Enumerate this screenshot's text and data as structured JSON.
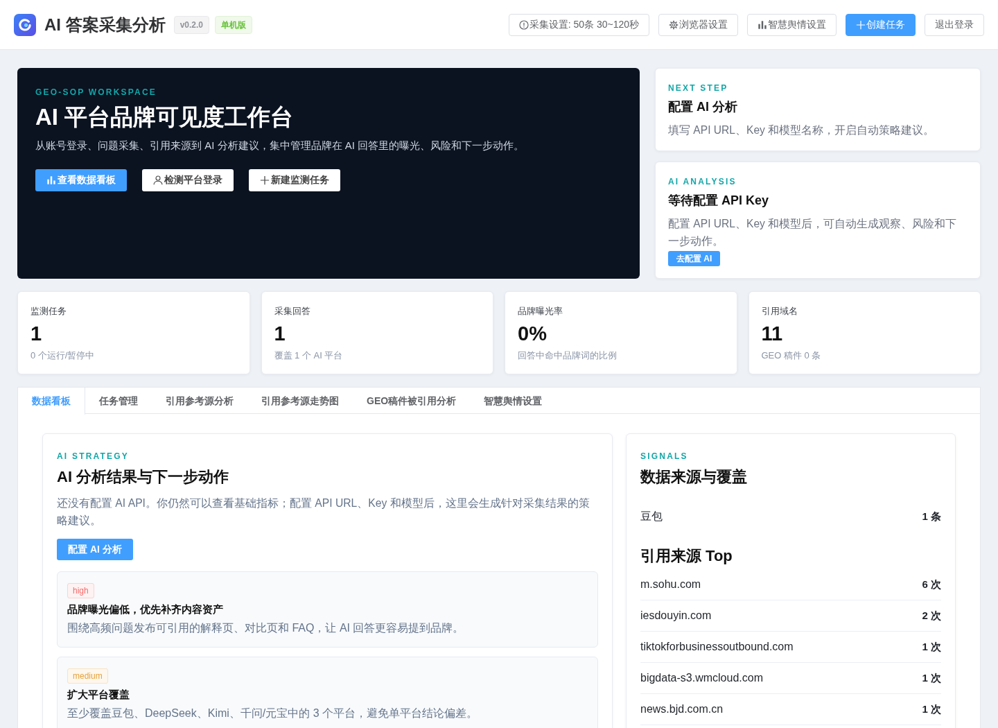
{
  "header": {
    "app_title": "AI 答案采集分析",
    "version": "v0.2.0",
    "edition": "单机版",
    "buttons": [
      {
        "label": "采集设置: 50条 30~120秒",
        "kind": "default"
      },
      {
        "label": "浏览器设置",
        "kind": "default"
      },
      {
        "label": "智慧舆情设置",
        "kind": "default"
      },
      {
        "label": "创建任务",
        "kind": "primary"
      },
      {
        "label": "退出登录",
        "kind": "default"
      }
    ]
  },
  "hero": {
    "eyebrow": "GEO-SOP WORKSPACE",
    "title": "AI 平台品牌可见度工作台",
    "description": "从账号登录、问题采集、引用来源到 AI 分析建议，集中管理品牌在 AI 回答里的曝光、风险和下一步动作。",
    "buttons": [
      {
        "label": "查看数据看板",
        "kind": "primary"
      },
      {
        "label": "检测平台登录",
        "kind": "default"
      },
      {
        "label": "新建监测任务",
        "kind": "default"
      }
    ]
  },
  "side_cards": [
    {
      "eyebrow": "NEXT STEP",
      "title": "配置 AI 分析",
      "description": "填写 API URL、Key 和模型名称，开启自动策略建议。"
    },
    {
      "eyebrow": "AI ANALYSIS",
      "title": "等待配置 API Key",
      "description": "配置 API URL、Key 和模型后，可自动生成观察、风险和下一步动作。",
      "button": "去配置 AI"
    }
  ],
  "stats": [
    {
      "label": "监测任务",
      "value": "1",
      "note": "0 个运行/暂停中"
    },
    {
      "label": "采集回答",
      "value": "1",
      "note": "覆盖 1 个 AI 平台"
    },
    {
      "label": "品牌曝光率",
      "value": "0%",
      "note": "回答中命中品牌词的比例"
    },
    {
      "label": "引用域名",
      "value": "11",
      "note": "GEO 稿件 0 条"
    }
  ],
  "tabs": [
    {
      "label": "数据看板",
      "selected": true
    },
    {
      "label": "任务管理",
      "selected": false
    },
    {
      "label": "引用参考源分析",
      "selected": false
    },
    {
      "label": "引用参考源走势图",
      "selected": false
    },
    {
      "label": "GEO稿件被引用分析",
      "selected": false
    },
    {
      "label": "智慧舆情设置",
      "selected": false
    }
  ],
  "strategy": {
    "eyebrow": "AI STRATEGY",
    "title": "AI 分析结果与下一步动作",
    "description": "还没有配置 AI API。你仍然可以查看基础指标；配置 API URL、Key 和模型后，这里会生成针对采集结果的策略建议。",
    "button": "配置 AI 分析",
    "items": [
      {
        "priority": "high",
        "color": "#f56c6c",
        "title": "品牌曝光偏低，优先补齐内容资产",
        "description": "围绕高频问题发布可引用的解释页、对比页和 FAQ，让 AI 回答更容易提到品牌。"
      },
      {
        "priority": "medium",
        "color": "#e6a23c",
        "title": "扩大平台覆盖",
        "description": "至少覆盖豆包、DeepSeek、Kimi、千问/元宝中的 3 个平台，避免单平台结论偏差。"
      }
    ]
  },
  "signals": {
    "eyebrow": "SIGNALS",
    "title": "数据来源与覆盖",
    "platforms": [
      {
        "name": "豆包",
        "count": "1 条"
      }
    ],
    "sources_title": "引用来源 Top",
    "sources": [
      {
        "domain": "m.sohu.com",
        "count": "6 次"
      },
      {
        "domain": "iesdouyin.com",
        "count": "2 次"
      },
      {
        "domain": "tiktokforbusinessoutbound.com",
        "count": "1 次"
      },
      {
        "domain": "bigdata-s3.wmcloud.com",
        "count": "1 次"
      },
      {
        "domain": "news.bjd.com.cn",
        "count": "1 次"
      }
    ]
  }
}
